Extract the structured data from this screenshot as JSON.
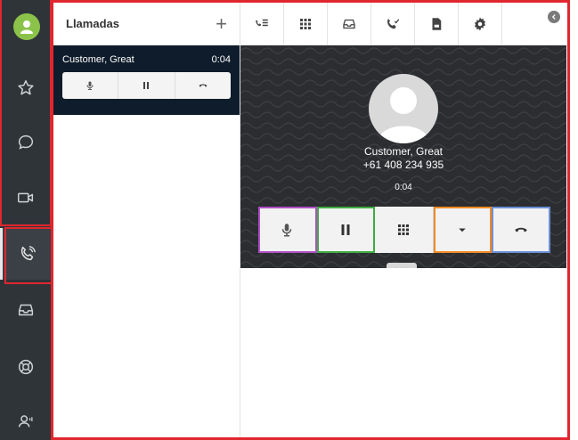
{
  "calls_panel": {
    "title": "Llamadas",
    "add_label": "+"
  },
  "call_card": {
    "name": "Customer, Great",
    "duration": "0:04"
  },
  "stage": {
    "name": "Customer, Great",
    "number": "+61 408 234 935",
    "timer": "0:04",
    "handle": "- - -"
  },
  "rail": {
    "items": [
      {
        "icon": "star-icon"
      },
      {
        "icon": "chat-icon"
      },
      {
        "icon": "video-icon"
      },
      {
        "icon": "phone-active-icon"
      },
      {
        "icon": "inbox-icon"
      },
      {
        "icon": "lifebuoy-icon"
      },
      {
        "icon": "user-list-icon"
      }
    ]
  },
  "toolbar": {
    "items": [
      {
        "icon": "call-list-icon"
      },
      {
        "icon": "dialpad-icon"
      },
      {
        "icon": "inbox-icon"
      },
      {
        "icon": "missed-call-icon"
      },
      {
        "icon": "voicemail-icon"
      },
      {
        "icon": "settings-icon"
      }
    ]
  },
  "colors": {
    "rail_bg": "#2f3438",
    "card_bg": "#0f1c2b",
    "stage_bg": "#2b2d30",
    "highlight_red": "#e0262f",
    "highlight_purple": "#b04fc7",
    "highlight_green": "#3dad3f",
    "highlight_orange": "#f08a24",
    "highlight_blue": "#6b8fd6"
  }
}
